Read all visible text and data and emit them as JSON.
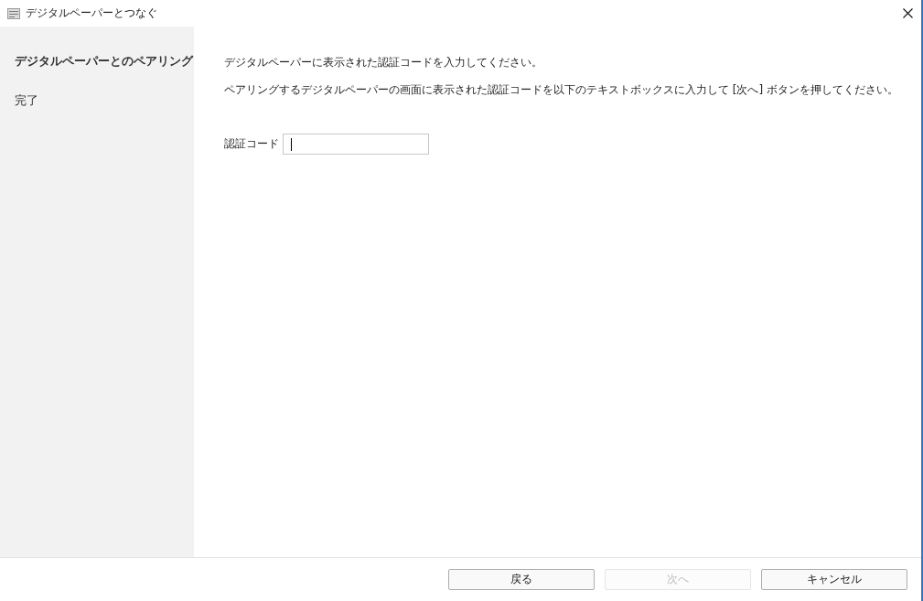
{
  "window": {
    "title": "デジタルペーパーとつなぐ"
  },
  "steps": [
    {
      "label": "デジタルペーパーとのペアリング",
      "selected": true
    },
    {
      "label": "完了",
      "selected": false
    }
  ],
  "instructions": [
    "デジタルペーパーに表示された認証コードを入力してください。",
    "ペアリングするデジタルペーパーの画面に表示された認証コードを以下のテキストボックスに入力して [次へ] ボタンを押してください。"
  ],
  "code_field": {
    "label": "認証コード",
    "focused": true
  },
  "buttons": [
    {
      "label": "戻る",
      "disabled": false
    },
    {
      "label": "次へ",
      "disabled": true
    },
    {
      "label": "キャンセル",
      "disabled": false
    }
  ]
}
